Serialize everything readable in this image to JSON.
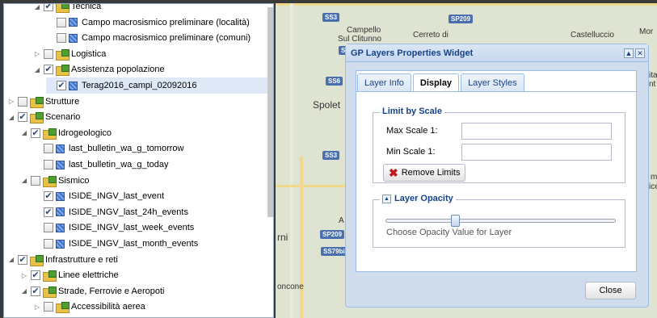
{
  "tree": {
    "items": [
      {
        "label": "Tecnica",
        "expanded": true,
        "checked": true,
        "type": "folder"
      },
      {
        "label": "Campo macrosismico preliminare (località)",
        "checked": false,
        "type": "layer"
      },
      {
        "label": "Campo macrosismico preliminare (comuni)",
        "checked": false,
        "type": "layer"
      },
      {
        "label": "Logistica",
        "expanded": false,
        "checked": false,
        "type": "folder"
      },
      {
        "label": "Assistenza popolazione",
        "expanded": true,
        "checked": true,
        "type": "folder"
      },
      {
        "label": "Terag2016_campi_02092016",
        "checked": true,
        "type": "layer",
        "selected": true
      },
      {
        "label": "Strutture",
        "expanded": false,
        "checked": false,
        "type": "folder"
      },
      {
        "label": "Scenario",
        "expanded": true,
        "checked": true,
        "type": "folder"
      },
      {
        "label": "Idrogeologico",
        "expanded": true,
        "checked": true,
        "type": "folder"
      },
      {
        "label": "last_bulletin_wa_g_tomorrow",
        "checked": false,
        "type": "layer"
      },
      {
        "label": "last_bulletin_wa_g_today",
        "checked": false,
        "type": "layer"
      },
      {
        "label": "Sismico",
        "expanded": true,
        "checked": false,
        "type": "folder"
      },
      {
        "label": "ISIDE_INGV_last_event",
        "checked": true,
        "type": "layer"
      },
      {
        "label": "ISIDE_INGV_last_24h_events",
        "checked": true,
        "type": "layer"
      },
      {
        "label": "ISIDE_INGV_last_week_events",
        "checked": false,
        "type": "layer"
      },
      {
        "label": "ISIDE_INGV_last_month_events",
        "checked": false,
        "type": "layer"
      },
      {
        "label": "Infrastrutture e reti",
        "expanded": true,
        "checked": true,
        "type": "folder"
      },
      {
        "label": "Linee elettriche",
        "expanded": false,
        "checked": true,
        "type": "folder"
      },
      {
        "label": "Strade, Ferrovie e Aeropoti",
        "expanded": true,
        "checked": true,
        "type": "folder"
      },
      {
        "label": "Accessibilità aerea",
        "expanded": false,
        "checked": false,
        "type": "folder"
      }
    ]
  },
  "map": {
    "labels": [
      "Campello",
      "Sul Clitunno",
      "Cerreto di",
      "Castelluccio",
      "Mor",
      "Spolet",
      "rni",
      "oncone",
      "A",
      "ita",
      "nt",
      "m",
      "ice"
    ],
    "shields": [
      "SS3",
      "SP209",
      "SS3",
      "SS6",
      "SS3",
      "SP209",
      "SS79bis"
    ]
  },
  "widget": {
    "title": "GP Layers Properties Widget",
    "tabs": [
      "Layer Info",
      "Display",
      "Layer Styles"
    ],
    "active_tab": "Display",
    "scale": {
      "legend": "Limit by Scale",
      "max_label": "Max Scale 1:",
      "max_value": "",
      "min_label": "Min Scale 1:",
      "min_value": "",
      "remove_label": "Remove Limits"
    },
    "opacity": {
      "legend": "Layer Opacity",
      "value": 0.3,
      "hint": "Choose Opacity Value for Layer"
    },
    "close_label": "Close"
  }
}
